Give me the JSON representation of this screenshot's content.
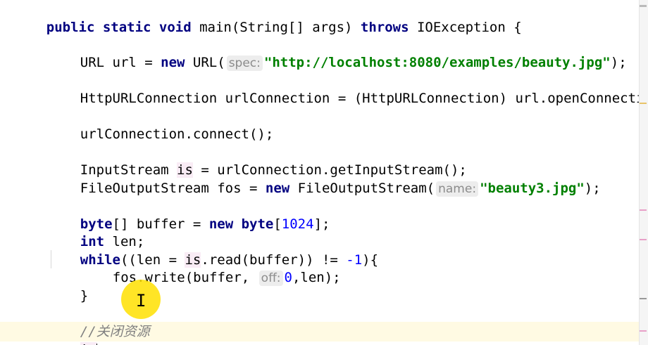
{
  "code": {
    "l1": {
      "a": "public static void ",
      "b": "main(String[] args) ",
      "c": "throws ",
      "d": "IOException {"
    },
    "l2": {
      "a": "URL url = ",
      "b": "new ",
      "c": "URL(",
      "hint": "spec:",
      "str": "\"http://localhost:8080/examples/beauty.jpg\"",
      "e": ");"
    },
    "l3": {
      "a": "HttpURLConnection urlConnection = (HttpURLConnection) url.openConnection("
    },
    "l4": {
      "a": "urlConnection.connect();"
    },
    "l5": {
      "a": "InputStream ",
      "b": "is",
      "c": " = urlConnection.getInputStream();"
    },
    "l6": {
      "a": "FileOutputStream fos = ",
      "b": "new ",
      "c": "FileOutputStream(",
      "hint": "name:",
      "str": "\"beauty3.jpg\"",
      "e": ");"
    },
    "l7": {
      "a": "byte",
      "b": "[] buffer = ",
      "c": "new ",
      "d": "byte",
      "e": "[",
      "num": "1024",
      "f": "];"
    },
    "l8": {
      "a": "int ",
      "b": "len;"
    },
    "l9": {
      "a": "while",
      "b": "((len = ",
      "c": "is",
      ".d": "",
      "d": ".read(buffer)) != ",
      "num": "-1",
      "e": "){"
    },
    "l10": {
      "a": "fos.write(buffer, ",
      "hint": "off:",
      "num": "0",
      "b": ",len);"
    },
    "l11": {
      "a": "}"
    },
    "l12": {
      "a": "//关闭资源"
    },
    "l13": {
      "a": "is"
    }
  },
  "colors": {
    "keyword": "#000080",
    "string": "#008000",
    "number": "#0000ff",
    "comment": "#808080",
    "current_line": "#fffae3"
  },
  "icons": {
    "cursor": "i-beam-icon"
  }
}
